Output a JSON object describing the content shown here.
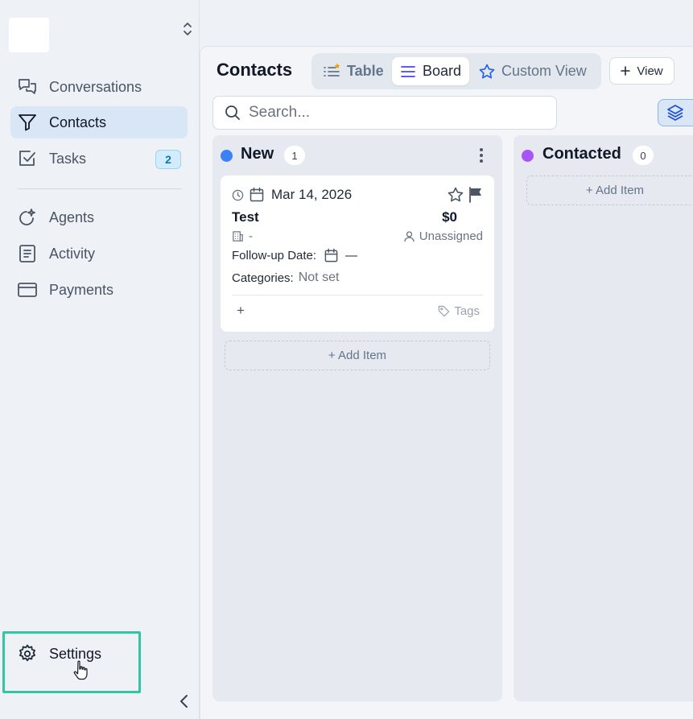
{
  "sidebar": {
    "items": [
      {
        "label": "Conversations",
        "icon": "chat-bubbles-icon"
      },
      {
        "label": "Contacts",
        "icon": "filter-icon",
        "active": true
      },
      {
        "label": "Tasks",
        "icon": "checkbox-icon",
        "badge": "2"
      },
      {
        "label": "Agents",
        "icon": "sparkle-agent-icon"
      },
      {
        "label": "Activity",
        "icon": "activity-log-icon"
      },
      {
        "label": "Payments",
        "icon": "credit-card-icon"
      }
    ],
    "settings_label": "Settings"
  },
  "header": {
    "title": "Contacts",
    "tabs": [
      {
        "label": "Table",
        "icon": "list-star-icon"
      },
      {
        "label": "Board",
        "icon": "board-lines-icon",
        "active": true
      },
      {
        "label": "Custom View",
        "icon": "star-outline-icon"
      }
    ],
    "add_view_label": "View",
    "add_view_icon": "plus-icon"
  },
  "search": {
    "placeholder": "Search..."
  },
  "board": {
    "columns": [
      {
        "title": "New",
        "count": "1",
        "color": "#3b82f6",
        "add_item_label": "+ Add Item"
      },
      {
        "title": "Contacted",
        "count": "0",
        "color": "#a855f7",
        "add_item_label": "+ Add Item"
      }
    ],
    "card": {
      "date": "Mar 14, 2026",
      "name": "Test",
      "amount": "$0",
      "company": "-",
      "assignee": "Unassigned",
      "followup_label": "Follow-up Date:",
      "followup_value": "—",
      "categories_label": "Categories:",
      "categories_value": "Not set",
      "add_label": "+",
      "tags_label": "Tags"
    }
  },
  "colors": {
    "accent": "#2563eb",
    "highlight": "#2fc7a3",
    "active_bg": "#d8e6f5"
  }
}
